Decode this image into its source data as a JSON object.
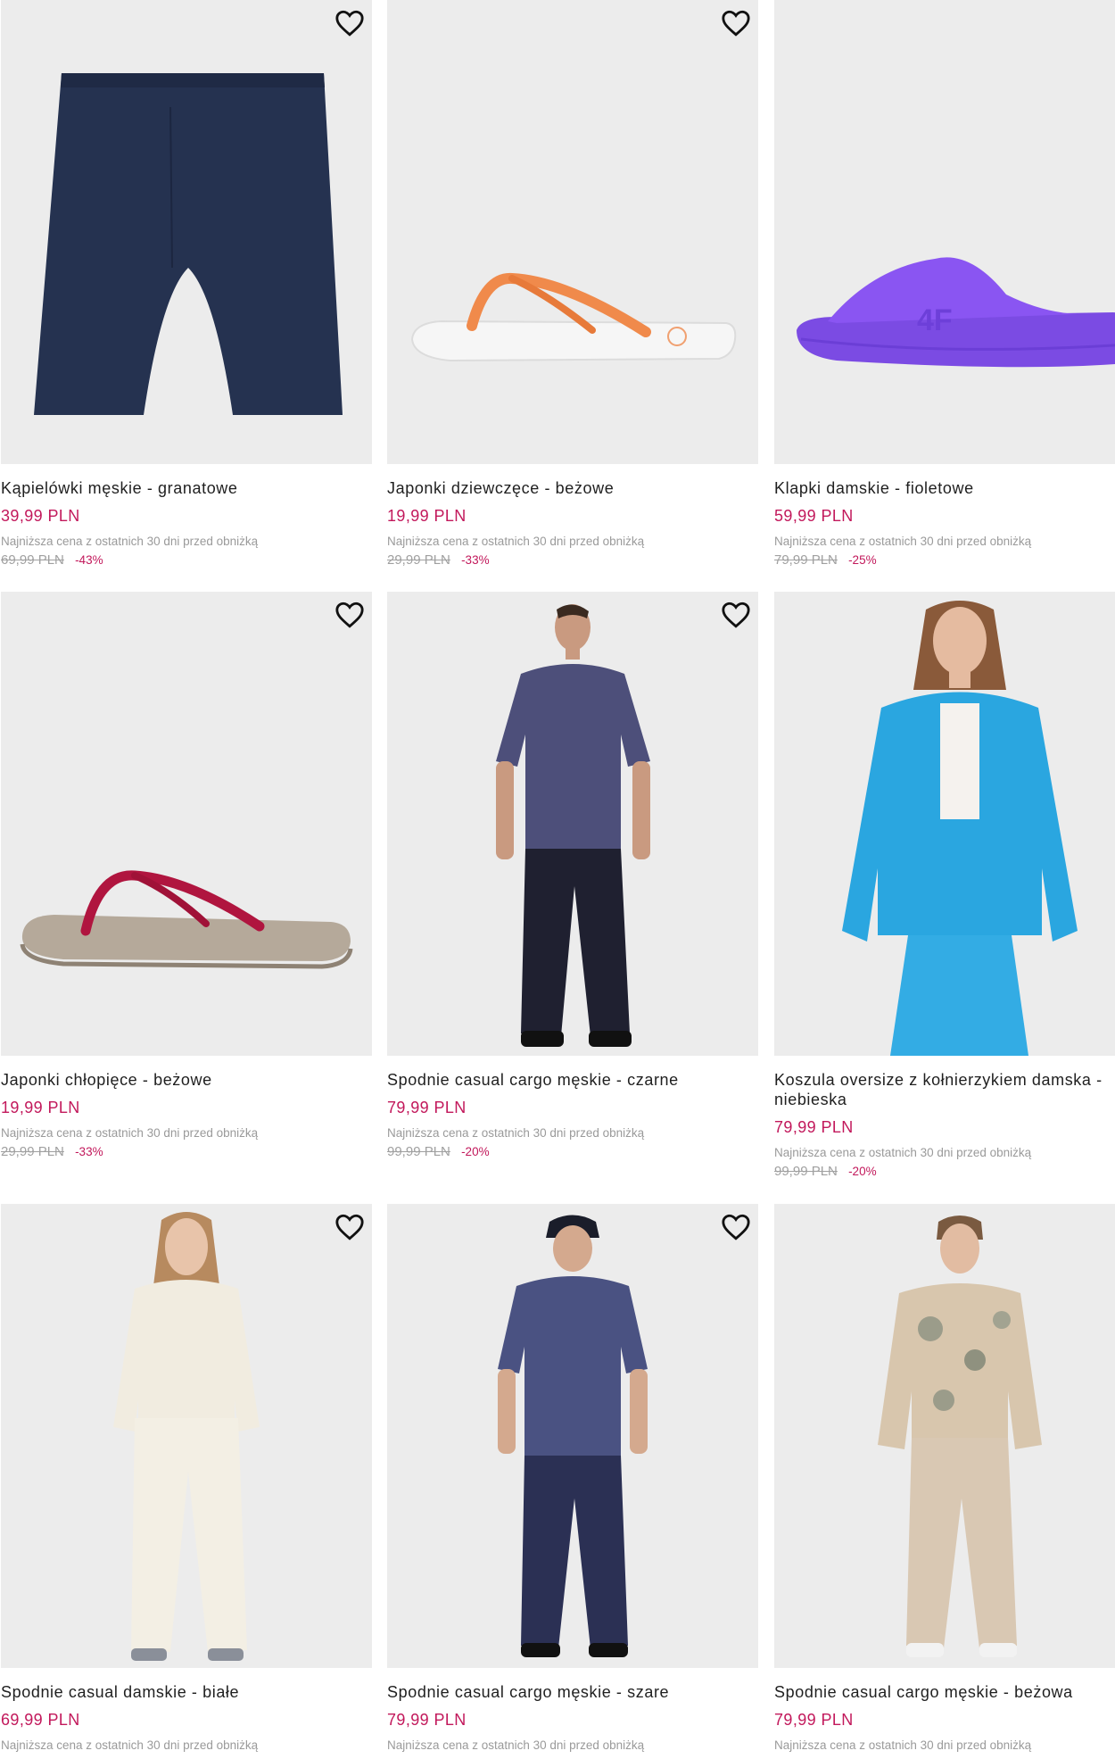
{
  "colors": {
    "price": "#c2185b",
    "image_bg": "#ececec",
    "muted": "#9a9a9a"
  },
  "icons": {
    "wishlist": "heart-icon"
  },
  "products": [
    {
      "name": "Kąpielówki męskie - granatowe",
      "price": "39,99 PLN",
      "lowest_note": "Najniższa cena z ostatnich 30 dni przed obniżką",
      "old_price": "69,99 PLN",
      "discount": "-43%"
    },
    {
      "name": "Japonki dziewczęce - beżowe",
      "price": "19,99 PLN",
      "lowest_note": "Najniższa cena z ostatnich 30 dni przed obniżką",
      "old_price": "29,99 PLN",
      "discount": "-33%"
    },
    {
      "name": "Klapki damskie - fioletowe",
      "price": "59,99 PLN",
      "lowest_note": "Najniższa cena z ostatnich 30 dni przed obniżką",
      "old_price": "79,99 PLN",
      "discount": "-25%"
    },
    {
      "name": "Japonki chłopięce - beżowe",
      "price": "19,99 PLN",
      "lowest_note": "Najniższa cena z ostatnich 30 dni przed obniżką",
      "old_price": "29,99 PLN",
      "discount": "-33%"
    },
    {
      "name": "Spodnie casual cargo męskie - czarne",
      "price": "79,99 PLN",
      "lowest_note": "Najniższa cena z ostatnich 30 dni przed obniżką",
      "old_price": "99,99 PLN",
      "discount": "-20%"
    },
    {
      "name": "Koszula oversize z kołnierzykiem damska - niebieska",
      "price": "79,99 PLN",
      "lowest_note": "Najniższa cena z ostatnich 30 dni przed obniżką",
      "old_price": "99,99 PLN",
      "discount": "-20%"
    },
    {
      "name": "Spodnie casual damskie - białe",
      "price": "69,99 PLN",
      "lowest_note": "Najniższa cena z ostatnich 30 dni przed obniżką"
    },
    {
      "name": "Spodnie casual cargo męskie - szare",
      "price": "79,99 PLN",
      "lowest_note": "Najniższa cena z ostatnich 30 dni przed obniżką"
    },
    {
      "name": "Spodnie casual cargo męskie - beżowa",
      "price": "79,99 PLN",
      "lowest_note": "Najniższa cena z ostatnich 30 dni przed obniżką"
    }
  ]
}
